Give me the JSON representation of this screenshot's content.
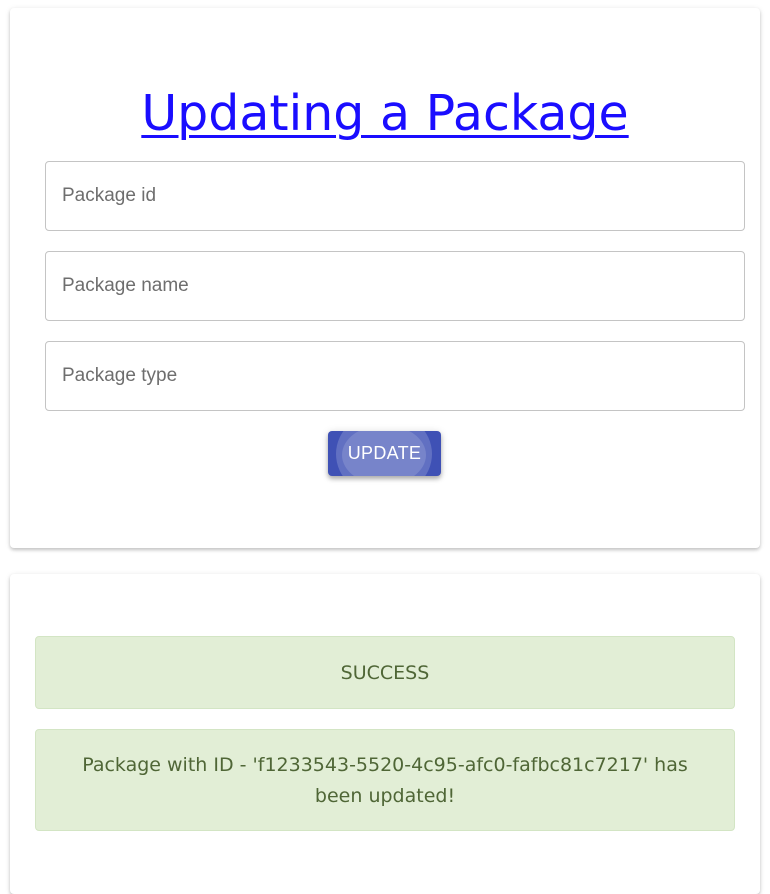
{
  "form": {
    "title": "Updating a Package",
    "fields": [
      {
        "placeholder": "Package id",
        "value": ""
      },
      {
        "placeholder": "Package name",
        "value": ""
      },
      {
        "placeholder": "Package type",
        "value": ""
      }
    ],
    "submit_label": "UPDATE",
    "accent_color": "#3f51b5",
    "link_color": "#1a0dff"
  },
  "result": {
    "status": "SUCCESS",
    "message": "Package with ID - 'f1233543-5520-4c95-afc0-fafbc81c7217' has been updated!",
    "alert_bg": "#e2eed6",
    "alert_text_color": "#4f6636"
  }
}
